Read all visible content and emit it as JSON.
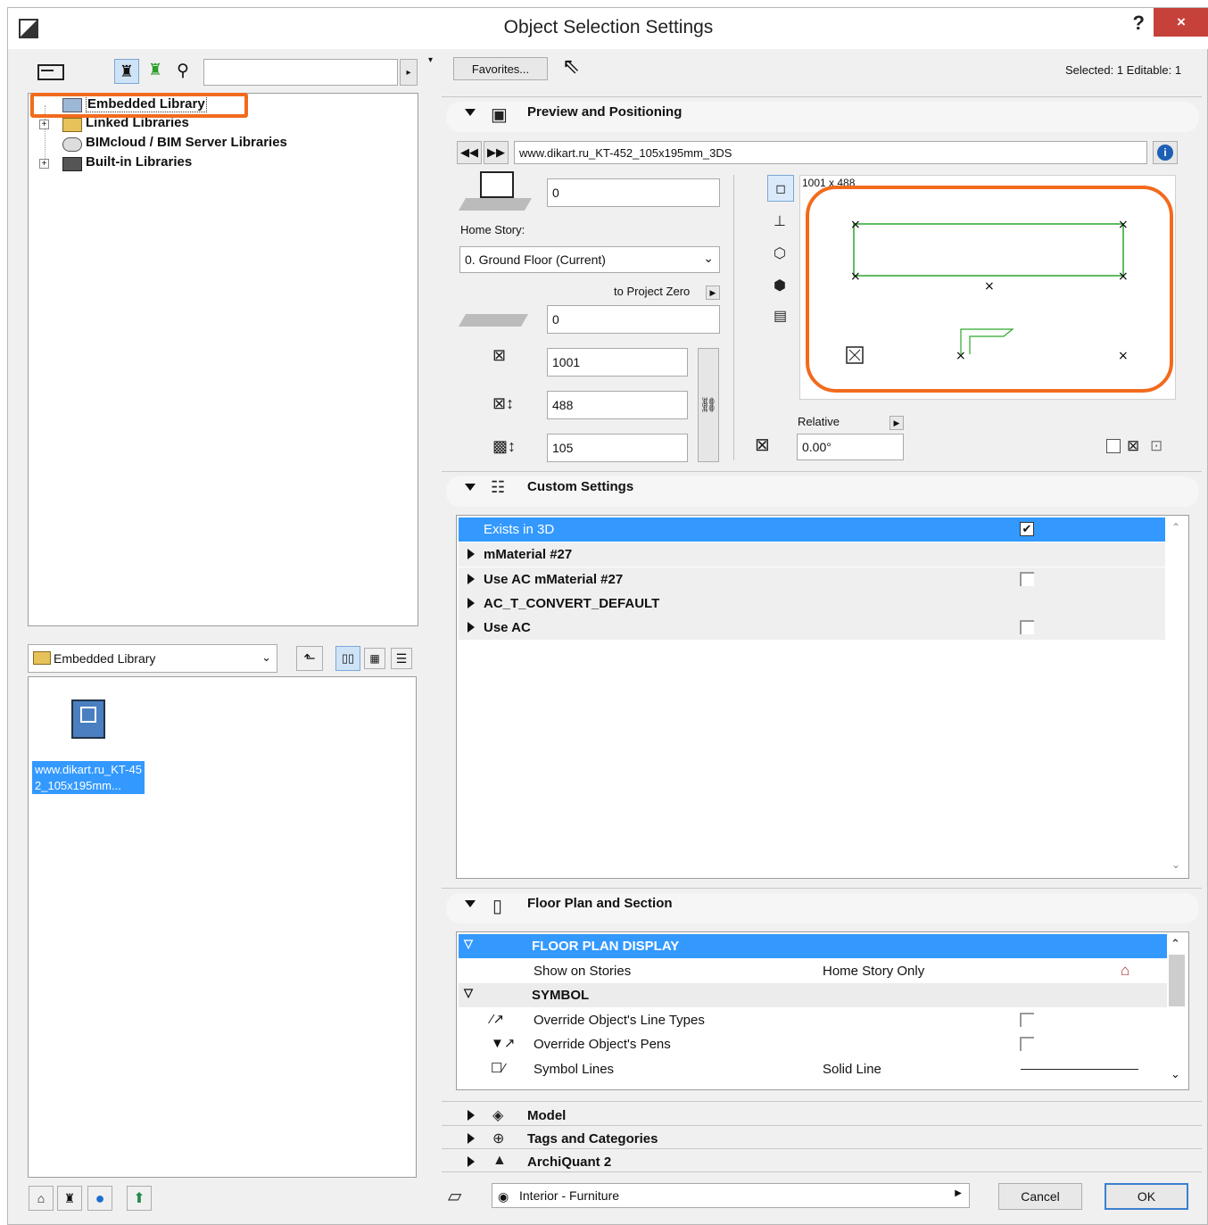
{
  "window": {
    "title": "Object Selection Settings",
    "help": "?",
    "close": "×"
  },
  "left": {
    "tree": {
      "items": [
        {
          "label": "Embedded Library"
        },
        {
          "label": "Linked Libraries"
        },
        {
          "label": "BIMcloud / BIM Server Libraries"
        },
        {
          "label": "Built-in Libraries"
        }
      ]
    },
    "folder_select": "Embedded Library",
    "thumbnail_label": "www.dikart.ru_KT-452_105x195mm..."
  },
  "toolbar": {
    "favorites": "Favorites...",
    "selected_info": "Selected: 1 Editable: 1"
  },
  "preview": {
    "section_title": "Preview and Positioning",
    "object_name": "www.dikart.ru_KT-452_105x195mm_3DS",
    "elevation": "0",
    "home_story_label": "Home Story:",
    "home_story_value": "0. Ground Floor (Current)",
    "to_project_zero": "to Project Zero",
    "base_elevation": "0",
    "width": "1001",
    "depth": "488",
    "height": "105",
    "preview_size": "1001 x 488",
    "relative_label": "Relative",
    "angle": "0.00°"
  },
  "custom": {
    "section_title": "Custom Settings",
    "rows": [
      {
        "label": "Exists in 3D",
        "checked": true
      },
      {
        "label": "mMaterial #27"
      },
      {
        "label": "Use AC mMaterial #27",
        "checked": false
      },
      {
        "label": "AC_T_CONVERT_DEFAULT"
      },
      {
        "label": "Use AC",
        "checked": false
      }
    ]
  },
  "floorplan": {
    "section_title": "Floor Plan and Section",
    "group1": "FLOOR PLAN DISPLAY",
    "show_on_stories_label": "Show on Stories",
    "show_on_stories_value": "Home Story Only",
    "group2": "SYMBOL",
    "override_line_types": "Override Object's Line Types",
    "override_pens": "Override Object's Pens",
    "symbol_lines_label": "Symbol Lines",
    "symbol_lines_value": "Solid Line"
  },
  "collapsed_sections": {
    "model": "Model",
    "tags": "Tags and Categories",
    "archiquant": "ArchiQuant 2"
  },
  "footer": {
    "layer": "Interior - Furniture",
    "cancel": "Cancel",
    "ok": "OK"
  },
  "colors": {
    "highlight": "#3399ff",
    "annotation": "#f26b1d",
    "close_red": "#c7413b",
    "preview_green": "#2aa62a"
  }
}
